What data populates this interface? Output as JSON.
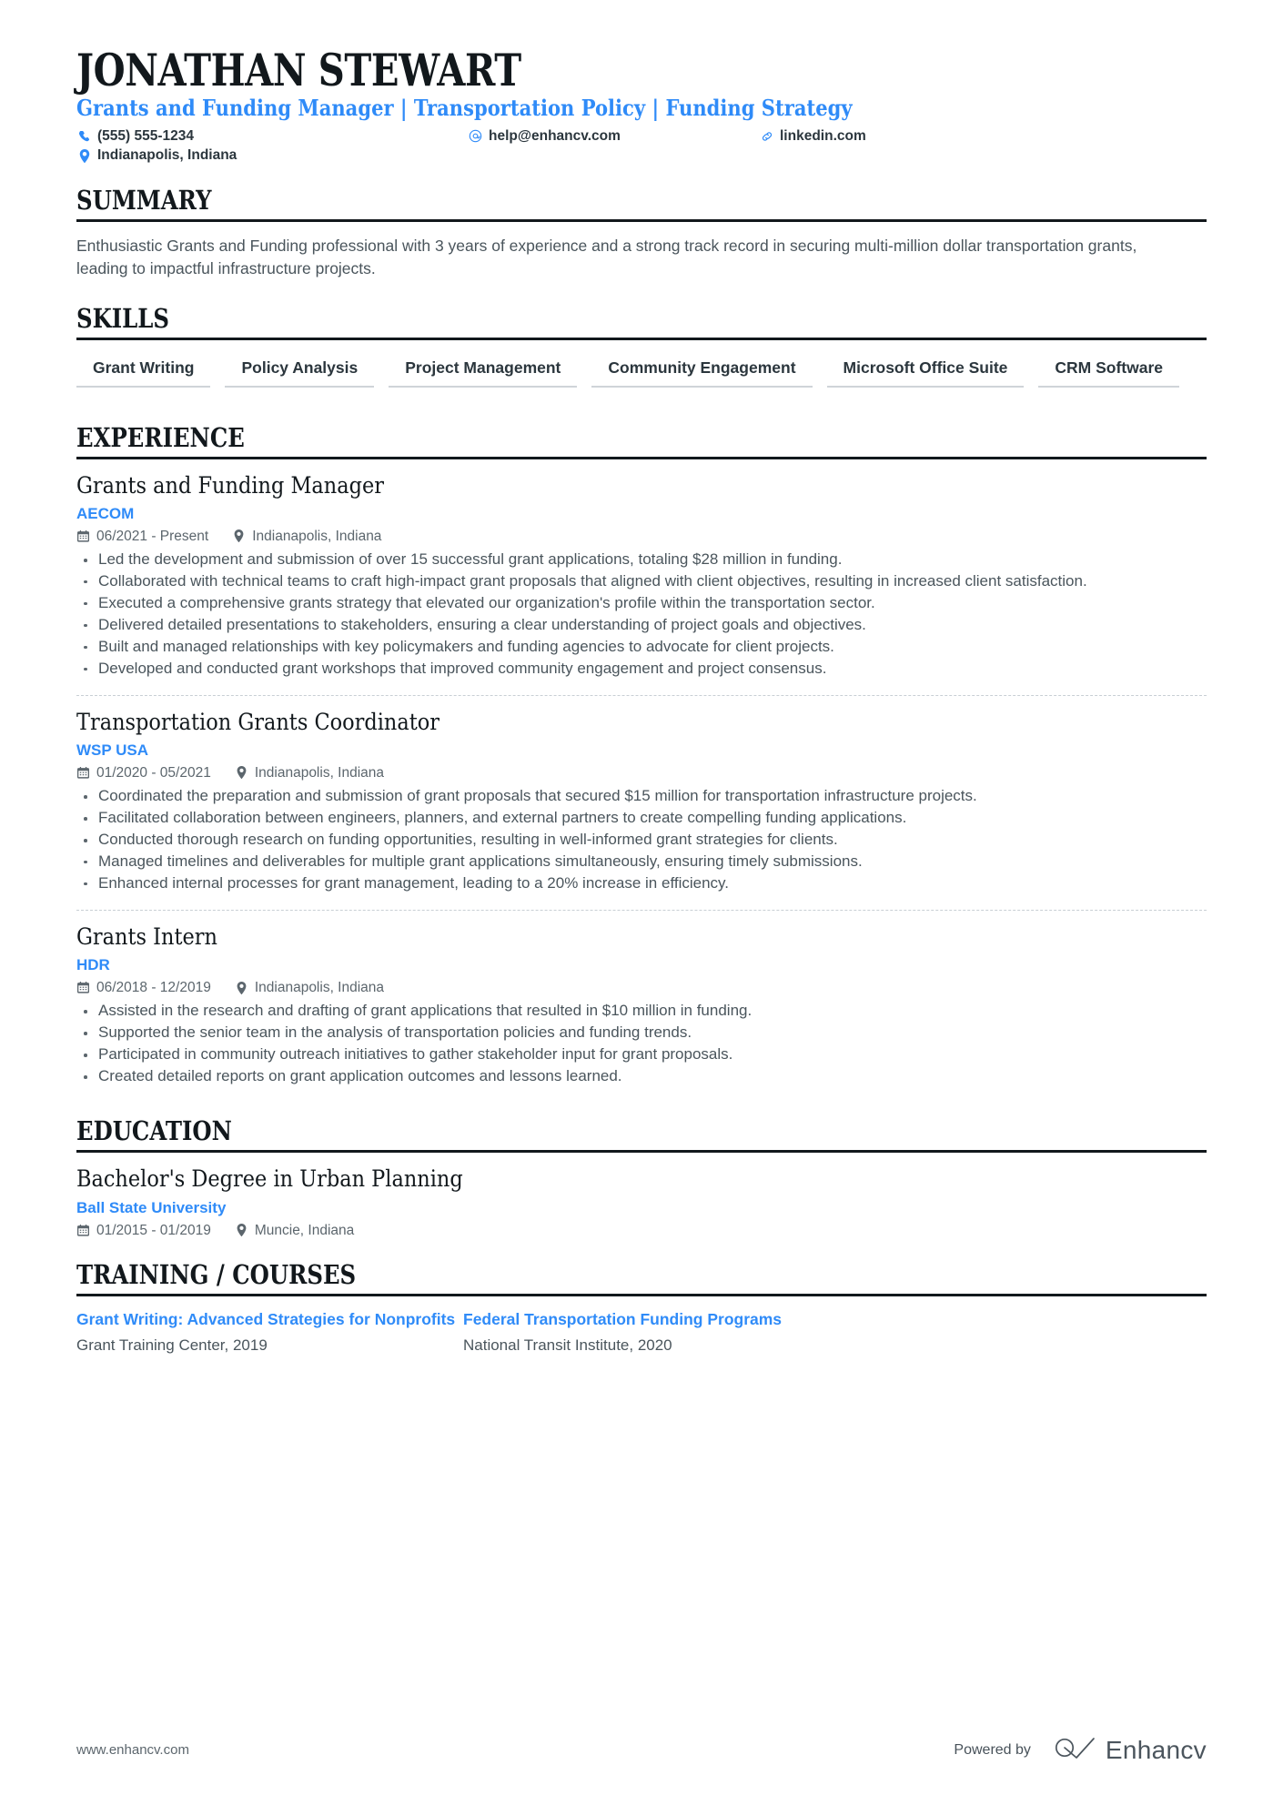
{
  "header": {
    "name": "JONATHAN STEWART",
    "headline": "Grants and Funding Manager | Transportation Policy | Funding Strategy",
    "contacts": [
      {
        "icon": "phone-icon",
        "text": "(555) 555-1234"
      },
      {
        "icon": "email-icon",
        "text": "help@enhancv.com"
      },
      {
        "icon": "link-icon",
        "text": "linkedin.com"
      },
      {
        "icon": "location-icon",
        "text": "Indianapolis, Indiana"
      }
    ]
  },
  "summary": {
    "title": "SUMMARY",
    "text": "Enthusiastic Grants and Funding professional with 3 years of experience and a strong track record in securing multi-million dollar transportation grants, leading to impactful infrastructure projects."
  },
  "skills": {
    "title": "SKILLS",
    "items": [
      "Grant Writing",
      "Policy Analysis",
      "Project Management",
      "Community Engagement",
      "Microsoft Office Suite",
      "CRM Software"
    ]
  },
  "experience": {
    "title": "EXPERIENCE",
    "jobs": [
      {
        "title": "Grants and Funding Manager",
        "company": "AECOM",
        "dates": "06/2021 - Present",
        "location": "Indianapolis, Indiana",
        "bullets": [
          "Led the development and submission of over 15 successful grant applications, totaling $28 million in funding.",
          "Collaborated with technical teams to craft high-impact grant proposals that aligned with client objectives, resulting in increased client satisfaction.",
          "Executed a comprehensive grants strategy that elevated our organization's profile within the transportation sector.",
          "Delivered detailed presentations to stakeholders, ensuring a clear understanding of project goals and objectives.",
          "Built and managed relationships with key policymakers and funding agencies to advocate for client projects.",
          "Developed and conducted grant workshops that improved community engagement and project consensus."
        ]
      },
      {
        "title": "Transportation Grants Coordinator",
        "company": "WSP USA",
        "dates": "01/2020 - 05/2021",
        "location": "Indianapolis, Indiana",
        "bullets": [
          "Coordinated the preparation and submission of grant proposals that secured $15 million for transportation infrastructure projects.",
          "Facilitated collaboration between engineers, planners, and external partners to create compelling funding applications.",
          "Conducted thorough research on funding opportunities, resulting in well-informed grant strategies for clients.",
          "Managed timelines and deliverables for multiple grant applications simultaneously, ensuring timely submissions.",
          "Enhanced internal processes for grant management, leading to a 20% increase in efficiency."
        ]
      },
      {
        "title": "Grants Intern",
        "company": "HDR",
        "dates": "06/2018 - 12/2019",
        "location": "Indianapolis, Indiana",
        "bullets": [
          "Assisted in the research and drafting of grant applications that resulted in $10 million in funding.",
          "Supported the senior team in the analysis of transportation policies and funding trends.",
          "Participated in community outreach initiatives to gather stakeholder input for grant proposals.",
          "Created detailed reports on grant application outcomes and lessons learned."
        ]
      }
    ]
  },
  "education": {
    "title": "EDUCATION",
    "entries": [
      {
        "degree": "Bachelor's Degree in Urban Planning",
        "school": "Ball State University",
        "dates": "01/2015 - 01/2019",
        "location": "Muncie, Indiana"
      }
    ]
  },
  "training": {
    "title": "TRAINING / COURSES",
    "courses": [
      {
        "name": "Grant Writing: Advanced Strategies for Nonprofits",
        "org": "Grant Training Center, 2019"
      },
      {
        "name": "Federal Transportation Funding Programs",
        "org": "National Transit Institute, 2020"
      }
    ]
  },
  "footer": {
    "url": "www.enhancv.com",
    "powered_by": "Powered by",
    "brand": "Enhancv"
  },
  "colors": {
    "accent": "#2f8bf8",
    "ink": "#12181c",
    "body": "#4a555c",
    "rule": "#12181c",
    "chip_underline": "#cfd4d8"
  }
}
